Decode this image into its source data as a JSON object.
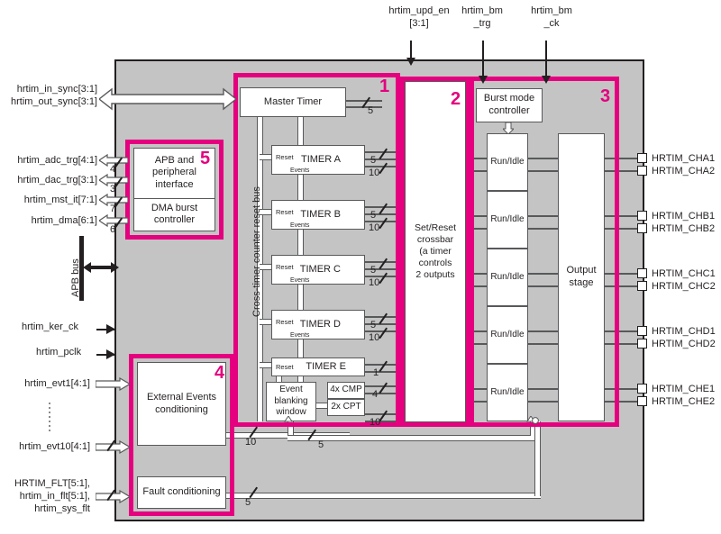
{
  "diagram": {
    "title": "HRTIM block diagram",
    "accent_color": "#e4007e",
    "body_color": "#c4c4c4",
    "line_color": "#58595b"
  },
  "top_signals": [
    {
      "name": "hrtim_upd_en",
      "line2": "[3:1]"
    },
    {
      "name": "hrtim_bm",
      "line2": "_trg"
    },
    {
      "name": "hrtim_bm",
      "line2": "_ck"
    }
  ],
  "left_signals": {
    "sync": [
      "hrtim_in_sync[3:1]",
      "hrtim_out_sync[3:1]"
    ],
    "irq_dma": [
      {
        "label": "hrtim_adc_trg[4:1]",
        "width": "4"
      },
      {
        "label": "hrtim_dac_trg[3:1]",
        "width": "3"
      },
      {
        "label": "hrtim_mst_it[7:1]",
        "width": "7"
      },
      {
        "label": "hrtim_dma[6:1]",
        "width": "6"
      }
    ],
    "apb_bus_label": "APB bus",
    "clocks": [
      "hrtim_ker_ck",
      "hrtim_pclk"
    ],
    "events": [
      {
        "label": "hrtim_evt1[4:1]"
      },
      {
        "label": "hrtim_evt10[4:1]"
      }
    ],
    "faults": [
      "HRTIM_FLT[5:1],",
      "hrtim_in_flt[5:1],",
      "hrtim_sys_flt"
    ]
  },
  "regions": [
    {
      "number": "1",
      "name": "timers-region"
    },
    {
      "number": "2",
      "name": "crossbar-region"
    },
    {
      "number": "3",
      "name": "output-region"
    },
    {
      "number": "4",
      "name": "external-events-region"
    },
    {
      "number": "5",
      "name": "apb-region"
    }
  ],
  "blocks": {
    "master_timer": "Master Timer",
    "timers": [
      "TIMER A",
      "TIMER B",
      "TIMER C",
      "TIMER D",
      "TIMER E"
    ],
    "reset_tag": "Reset",
    "events_tag": "Events",
    "cross_timer_bus": "Cross-timer counter reset bus",
    "event_blanking": "Event\nblanking\nwindow",
    "event_blanking_lines": [
      "Event",
      "blanking",
      "window"
    ],
    "cmp": "4x CMP",
    "cpt": "2x CPT",
    "crossbar_lines": [
      "Set/Reset",
      "crossbar",
      "(a timer controls",
      "2 outputs"
    ],
    "burst_mode_controller_lines": [
      "Burst mode",
      "controller"
    ],
    "run_idle": "Run/Idle",
    "run_idle_count": 5,
    "output_stage_lines": [
      "Output",
      "stage"
    ],
    "apb_interface_lines": [
      "APB and",
      "peripheral",
      "interface"
    ],
    "dma_burst_lines": [
      "DMA burst",
      "controller"
    ],
    "external_events_lines": [
      "External Events",
      "conditioning"
    ],
    "fault_conditioning": "Fault conditioning"
  },
  "bus_widths": {
    "master_timer": "5",
    "timer_abcd": [
      "5",
      "10"
    ],
    "timer_e": [
      "1",
      "4",
      "10"
    ],
    "ext_events_out": "10",
    "blanking_out": "5",
    "fault_out": "5"
  },
  "outputs": [
    "HRTIM_CHA1",
    "HRTIM_CHA2",
    "HRTIM_CHB1",
    "HRTIM_CHB2",
    "HRTIM_CHC1",
    "HRTIM_CHC2",
    "HRTIM_CHD1",
    "HRTIM_CHD2",
    "HRTIM_CHE1",
    "HRTIM_CHE2"
  ]
}
